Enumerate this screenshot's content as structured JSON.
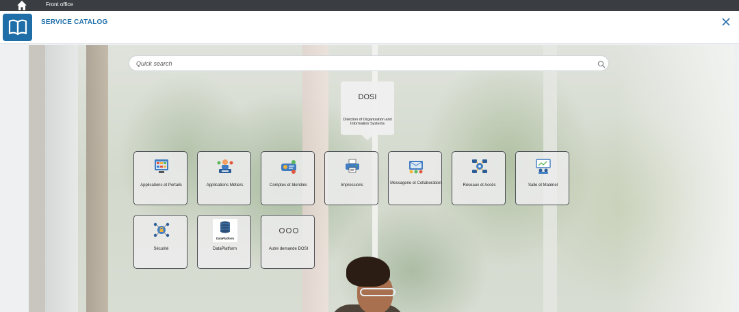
{
  "topbar": {
    "label": "Front office",
    "home_icon": "home-icon"
  },
  "header": {
    "title": "SERVICE CATALOG",
    "logo_icon": "open-book-icon",
    "close_icon": "close-icon",
    "accent": "#1f6ea8"
  },
  "search": {
    "placeholder": "Quick search",
    "value": "",
    "icon": "search-icon"
  },
  "dosi": {
    "name": "DOSI",
    "description": "Direction of Organization and Information Systems"
  },
  "tiles": [
    {
      "label": "Applications et Portails",
      "icon": "applications-portals-icon"
    },
    {
      "label": "Applications Métiers",
      "icon": "business-applications-icon"
    },
    {
      "label": "Comptes et Identités",
      "icon": "accounts-identities-icon"
    },
    {
      "label": "Impressions",
      "icon": "printer-icon"
    },
    {
      "label": "Messagerie et Collaboration",
      "icon": "messaging-collaboration-icon"
    },
    {
      "label": "Réseaux et Accès",
      "icon": "network-access-icon"
    },
    {
      "label": "Salle et Matériel",
      "icon": "room-equipment-icon"
    },
    {
      "label": "Sécurité",
      "icon": "security-icon"
    },
    {
      "label": "DataPlatform",
      "icon": "dataplatform-icon",
      "icon_text": "DataPlatform"
    },
    {
      "label": "Autre demande DOSI",
      "icon": "more-icon"
    }
  ]
}
